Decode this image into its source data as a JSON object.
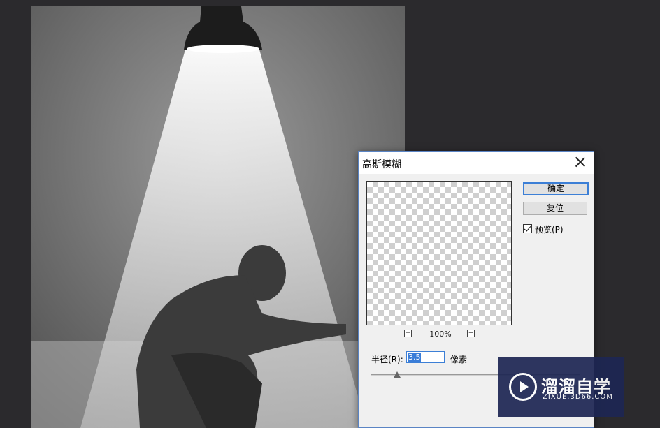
{
  "dialog": {
    "title": "高斯模糊",
    "ok_label": "确定",
    "reset_label": "复位",
    "preview_label": "预览(P)",
    "preview_checked": true,
    "zoom": "100%",
    "zoom_out": "−",
    "zoom_in": "+",
    "radius_label": "半径(R):",
    "radius_value": "3.5",
    "radius_unit": "像素"
  },
  "watermark": {
    "title": "溜溜自学",
    "subtitle": "ZIXUE.3D66.COM"
  },
  "colors": {
    "workspace": "#2b2a2d",
    "dialog_bg": "#f0f0f0",
    "accent": "#3c7fd6",
    "watermark_bg": "#1d2653"
  }
}
